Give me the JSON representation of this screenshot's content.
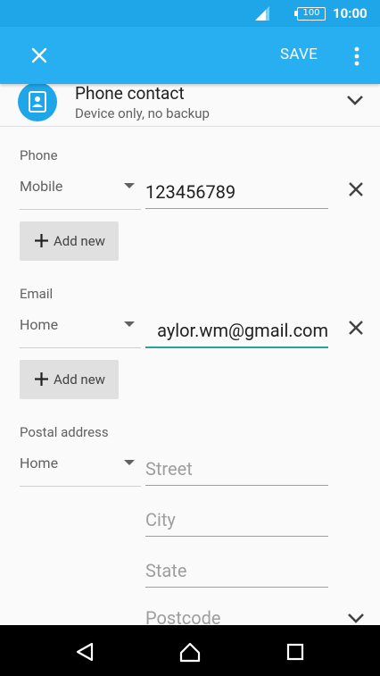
{
  "status_bar": {
    "battery": "100",
    "time": "10:00"
  },
  "toolbar": {
    "save_label": "SAVE"
  },
  "account": {
    "title": "Phone contact",
    "subtitle": "Device only, no backup"
  },
  "phone": {
    "section_label": "Phone",
    "type": "Mobile",
    "value": "123456789",
    "add_label": "Add new"
  },
  "email": {
    "section_label": "Email",
    "type": "Home",
    "value": "aylor.wm@gmail.com",
    "add_label": "Add new"
  },
  "postal": {
    "section_label": "Postal address",
    "type": "Home",
    "street_placeholder": "Street",
    "city_placeholder": "City",
    "state_placeholder": "State",
    "postcode_placeholder": "Postcode"
  },
  "colors": {
    "statusbar": "#1fa6e8",
    "toolbar": "#27aff2",
    "accent": "#26a69a"
  }
}
